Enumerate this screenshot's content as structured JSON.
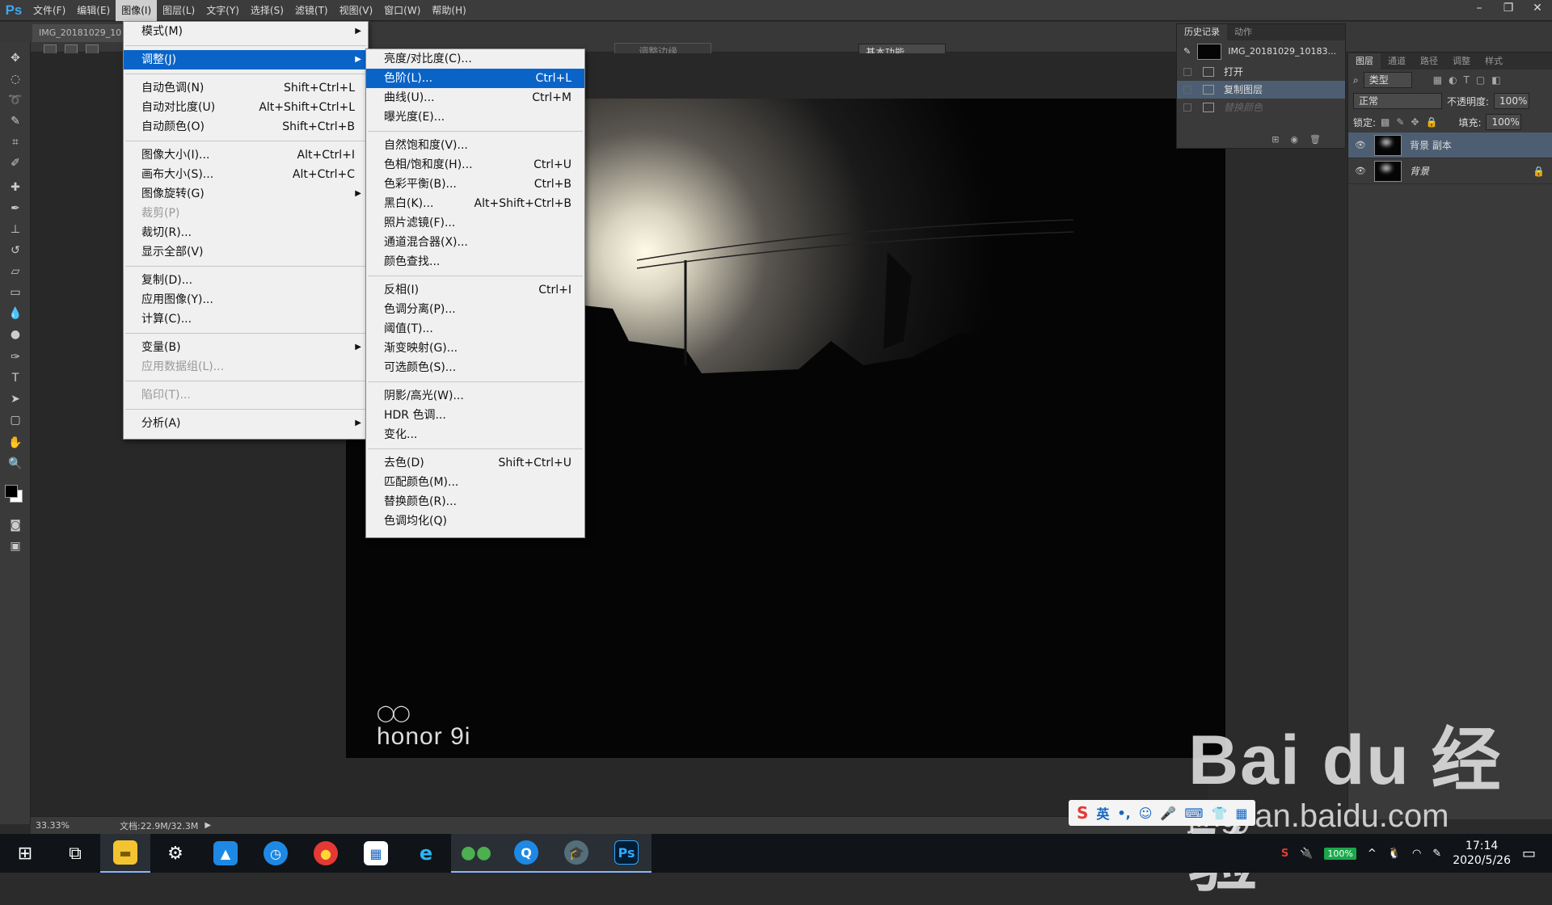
{
  "app": {
    "logo": "Ps"
  },
  "menubar": {
    "items": [
      "文件(F)",
      "编辑(E)",
      "图像(I)",
      "图层(L)",
      "文字(Y)",
      "选择(S)",
      "滤镜(T)",
      "视图(V)",
      "窗口(W)",
      "帮助(H)"
    ]
  },
  "window_controls": {
    "minimize": "–",
    "restore": "❐",
    "close": "✕"
  },
  "document_tab": {
    "title": "IMG_20181029_10"
  },
  "options": {
    "refine_edge": "调整边缘...",
    "workspace": "基本功能"
  },
  "image_menu": {
    "items": [
      {
        "label": "模式(M)",
        "shortcut": "",
        "submenu": true
      },
      {
        "sep": true
      },
      {
        "label": "调整(J)",
        "shortcut": "",
        "submenu": true,
        "highlight": true
      },
      {
        "sep": true
      },
      {
        "label": "自动色调(N)",
        "shortcut": "Shift+Ctrl+L"
      },
      {
        "label": "自动对比度(U)",
        "shortcut": "Alt+Shift+Ctrl+L"
      },
      {
        "label": "自动颜色(O)",
        "shortcut": "Shift+Ctrl+B"
      },
      {
        "sep": true
      },
      {
        "label": "图像大小(I)...",
        "shortcut": "Alt+Ctrl+I"
      },
      {
        "label": "画布大小(S)...",
        "shortcut": "Alt+Ctrl+C"
      },
      {
        "label": "图像旋转(G)",
        "shortcut": "",
        "submenu": true
      },
      {
        "label": "裁剪(P)",
        "shortcut": "",
        "disabled": true
      },
      {
        "label": "裁切(R)...",
        "shortcut": ""
      },
      {
        "label": "显示全部(V)",
        "shortcut": ""
      },
      {
        "sep": true
      },
      {
        "label": "复制(D)...",
        "shortcut": ""
      },
      {
        "label": "应用图像(Y)...",
        "shortcut": ""
      },
      {
        "label": "计算(C)...",
        "shortcut": ""
      },
      {
        "sep": true
      },
      {
        "label": "变量(B)",
        "shortcut": "",
        "submenu": true
      },
      {
        "label": "应用数据组(L)...",
        "shortcut": "",
        "disabled": true
      },
      {
        "sep": true
      },
      {
        "label": "陷印(T)...",
        "shortcut": "",
        "disabled": true
      },
      {
        "sep": true
      },
      {
        "label": "分析(A)",
        "shortcut": "",
        "submenu": true
      }
    ]
  },
  "adjust_submenu": {
    "items": [
      {
        "label": "亮度/对比度(C)...",
        "shortcut": ""
      },
      {
        "label": "色阶(L)...",
        "shortcut": "Ctrl+L",
        "highlight": true
      },
      {
        "label": "曲线(U)...",
        "shortcut": "Ctrl+M"
      },
      {
        "label": "曝光度(E)...",
        "shortcut": ""
      },
      {
        "sep": true
      },
      {
        "label": "自然饱和度(V)...",
        "shortcut": ""
      },
      {
        "label": "色相/饱和度(H)...",
        "shortcut": "Ctrl+U"
      },
      {
        "label": "色彩平衡(B)...",
        "shortcut": "Ctrl+B"
      },
      {
        "label": "黑白(K)...",
        "shortcut": "Alt+Shift+Ctrl+B"
      },
      {
        "label": "照片滤镜(F)...",
        "shortcut": ""
      },
      {
        "label": "通道混合器(X)...",
        "shortcut": ""
      },
      {
        "label": "颜色查找...",
        "shortcut": ""
      },
      {
        "sep": true
      },
      {
        "label": "反相(I)",
        "shortcut": "Ctrl+I"
      },
      {
        "label": "色调分离(P)...",
        "shortcut": ""
      },
      {
        "label": "阈值(T)...",
        "shortcut": ""
      },
      {
        "label": "渐变映射(G)...",
        "shortcut": ""
      },
      {
        "label": "可选颜色(S)...",
        "shortcut": ""
      },
      {
        "sep": true
      },
      {
        "label": "阴影/高光(W)...",
        "shortcut": ""
      },
      {
        "label": "HDR 色调...",
        "shortcut": ""
      },
      {
        "label": "变化...",
        "shortcut": ""
      },
      {
        "sep": true
      },
      {
        "label": "去色(D)",
        "shortcut": "Shift+Ctrl+U"
      },
      {
        "label": "匹配颜色(M)...",
        "shortcut": ""
      },
      {
        "label": "替换颜色(R)...",
        "shortcut": ""
      },
      {
        "label": "色调均化(Q)",
        "shortcut": ""
      }
    ]
  },
  "history_panel": {
    "tabs": [
      "历史记录",
      "动作"
    ],
    "snapshot": "IMG_20181029_10183...",
    "states": [
      {
        "label": "打开",
        "selected": false,
        "disabled": false
      },
      {
        "label": "复制图层",
        "selected": true,
        "disabled": false
      },
      {
        "label": "替换颜色",
        "selected": false,
        "disabled": true
      }
    ]
  },
  "layers_panel": {
    "tabs": [
      "图层",
      "通道",
      "路径",
      "调整",
      "样式"
    ],
    "filter": "类型",
    "blend_mode": "正常",
    "opacity_label": "不透明度:",
    "opacity": "100%",
    "lock_label": "锁定:",
    "fill_label": "填充:",
    "fill": "100%",
    "layers": [
      {
        "name": "背景 副本",
        "selected": true,
        "locked": false
      },
      {
        "name": "背景",
        "selected": false,
        "locked": true
      }
    ]
  },
  "canvas": {
    "watermark": "honor 9i"
  },
  "statusbar": {
    "zoom": "33.33%",
    "doc_size": "文档:22.9M/32.3M"
  },
  "ime": {
    "mode": "英"
  },
  "baidu": {
    "logo": "Bai du 经验",
    "url": "jingyan.baidu.com"
  },
  "taskbar": {
    "battery": "100%",
    "time": "17:14",
    "date": "2020/5/26"
  }
}
